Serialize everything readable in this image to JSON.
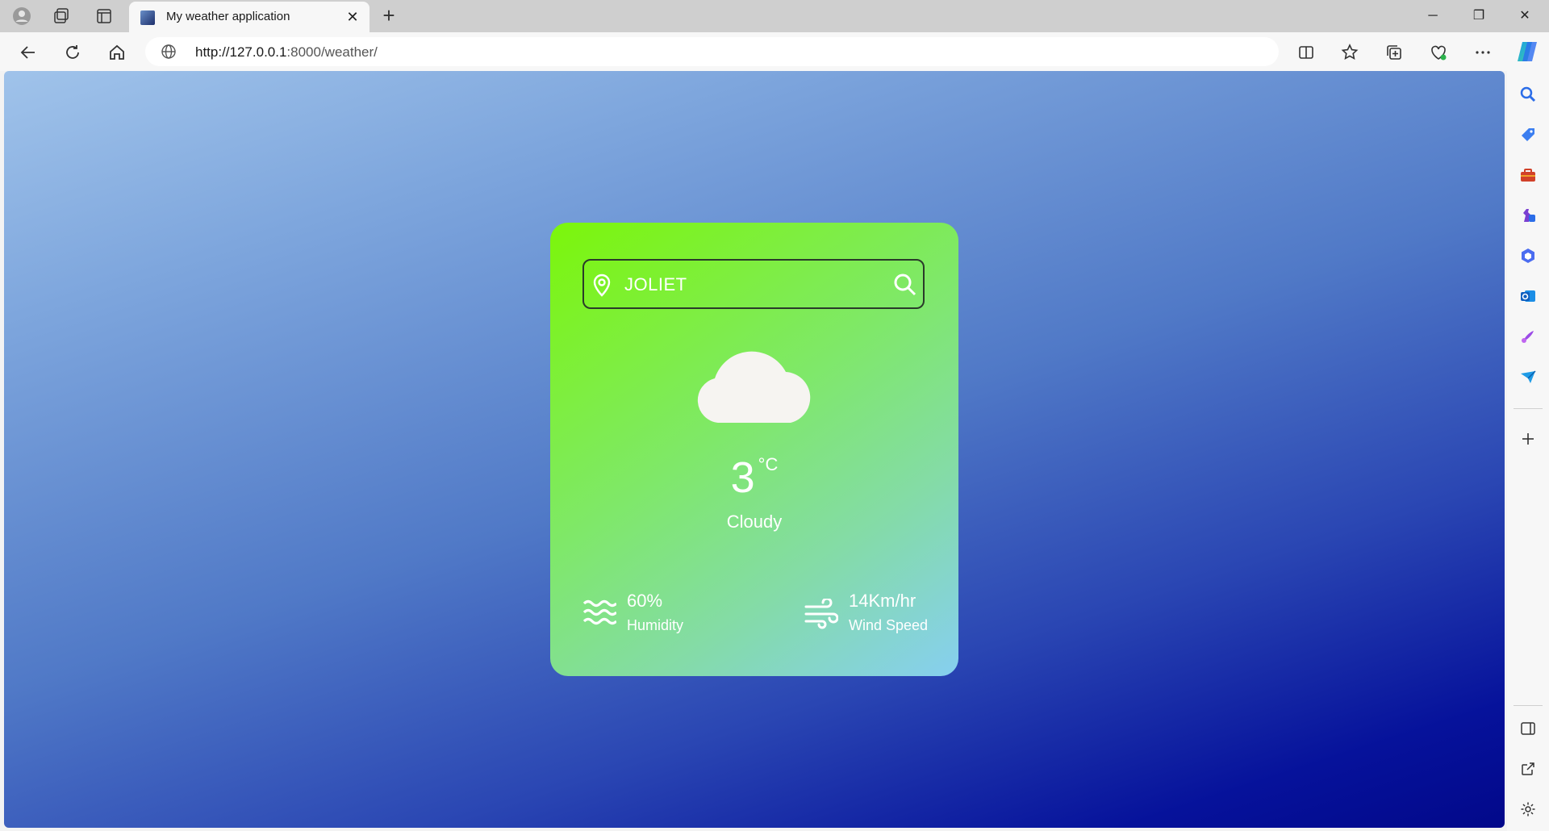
{
  "browser": {
    "tab_title": "My weather application",
    "url_host": "http://127.0.0.1",
    "url_rest": ":8000/weather/",
    "new_tab_label": "+",
    "close_tab_label": "✕"
  },
  "weather": {
    "city": "JOLIET",
    "temperature": "3",
    "unit": "°C",
    "condition": "Cloudy",
    "humidity_value": "60%",
    "humidity_label": "Humidity",
    "wind_value": "14Km/hr",
    "wind_label": "Wind Speed"
  },
  "colors": {
    "card_gradient_start": "#7cf60a",
    "card_gradient_end": "#86cff0",
    "page_gradient_start": "#a0c3ea",
    "page_gradient_end": "#02088a"
  }
}
